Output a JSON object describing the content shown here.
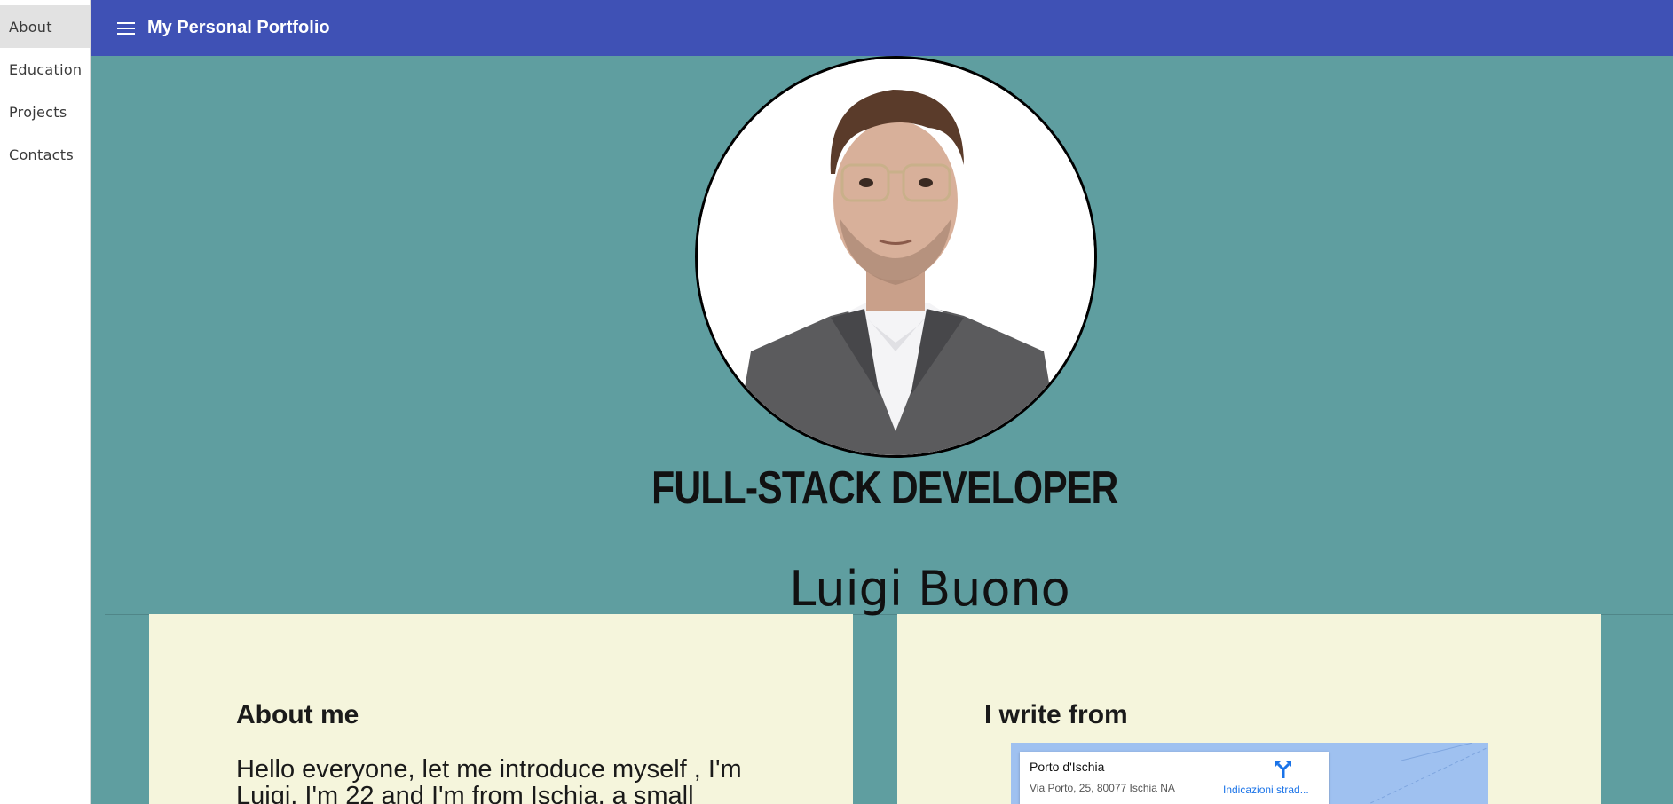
{
  "sidebar": {
    "items": [
      {
        "label": "About"
      },
      {
        "label": "Education"
      },
      {
        "label": "Projects"
      },
      {
        "label": "Contacts"
      }
    ]
  },
  "header": {
    "title": "My Personal Portfolio"
  },
  "hero": {
    "avatar_icon": "profile-photo",
    "role": "FULL-STACK DEVELOPER",
    "name": "Luigi Buono"
  },
  "about": {
    "heading": "About me",
    "text": "Hello everyone, let me introduce myself , I'm Luigi, I'm 22 and I'm from Ischia, a small"
  },
  "location": {
    "heading": "I write from",
    "place_name": "Porto d'Ischia",
    "address": "Via Porto, 25, 80077 Ischia NA",
    "directions_label": "Indicazioni strad..."
  },
  "colors": {
    "header_bg": "#3f51b5",
    "page_bg": "#5f9ea0",
    "card_bg": "#f5f5dc",
    "sidebar_active_bg": "#e2e2e2",
    "map_water": "#9fc1f0",
    "link": "#1a73e8"
  }
}
